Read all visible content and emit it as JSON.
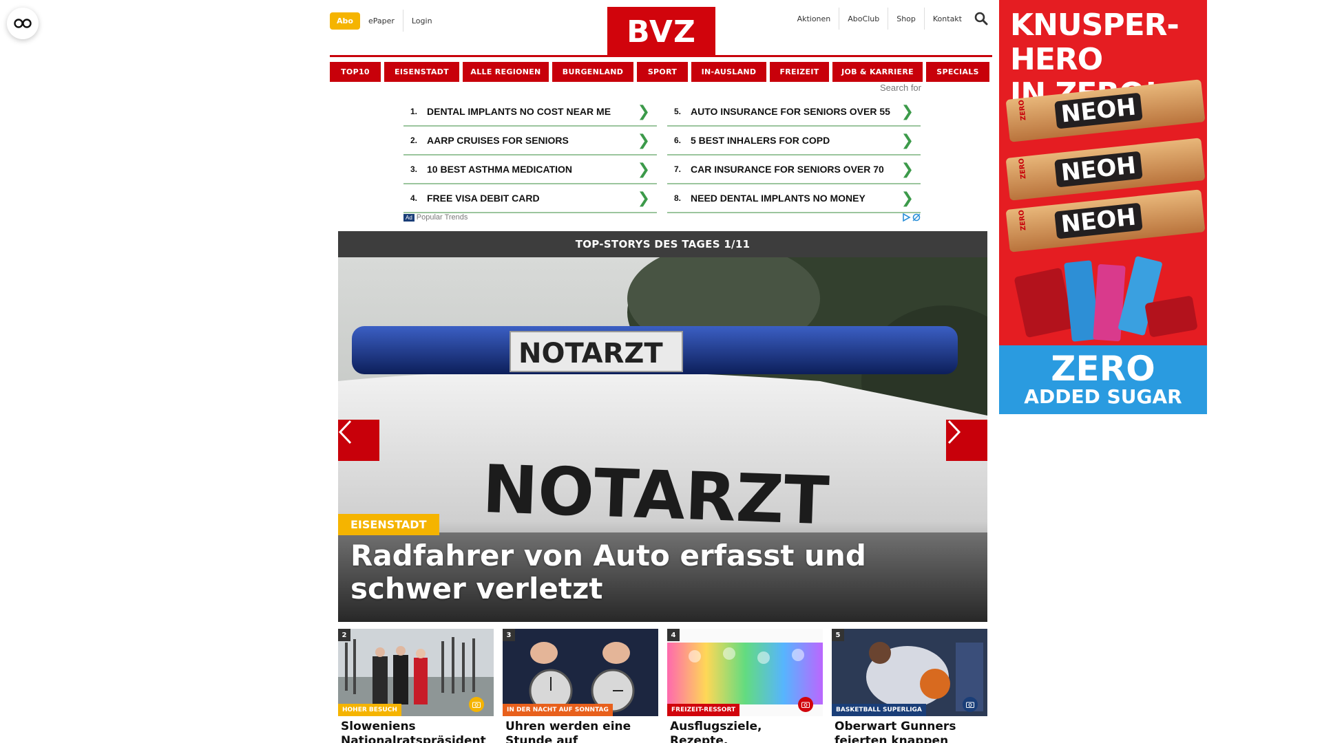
{
  "header": {
    "abo_label": "Abo",
    "epaper_label": "ePaper",
    "login_label": "Login",
    "logo_text": "BVZ",
    "right_links": [
      "Aktionen",
      "AboClub",
      "Shop",
      "Kontakt"
    ]
  },
  "nav": [
    "TOP10",
    "EISENSTADT",
    "ALLE REGIONEN",
    "BURGENLAND",
    "SPORT",
    "IN-AUSLAND",
    "FREIZEIT",
    "JOB & KARRIERE",
    "SPECIALS"
  ],
  "trends": {
    "search_for": "Search for",
    "left": [
      {
        "num": "1.",
        "text": "DENTAL IMPLANTS NO COST NEAR ME"
      },
      {
        "num": "2.",
        "text": "AARP CRUISES FOR SENIORS"
      },
      {
        "num": "3.",
        "text": "10 BEST ASTHMA MEDICATION"
      },
      {
        "num": "4.",
        "text": "FREE VISA DEBIT CARD"
      }
    ],
    "right": [
      {
        "num": "5.",
        "text": "AUTO INSURANCE FOR SENIORS OVER 55"
      },
      {
        "num": "6.",
        "text": "5 BEST INHALERS FOR COPD"
      },
      {
        "num": "7.",
        "text": "CAR INSURANCE FOR SENIORS OVER 70"
      },
      {
        "num": "8.",
        "text": "NEED DENTAL IMPLANTS NO MONEY"
      }
    ],
    "arrow": "❯",
    "ad_badge": "Ad",
    "ad_source": "Popular Trends"
  },
  "hero": {
    "heading": "TOP-STORYS DES TAGES 1/11",
    "tag": "EISENSTADT",
    "title": "Radfahrer von Auto erfasst und schwer verletzt",
    "image_text": "NOTARZT",
    "image_text_large": "NOTARZT"
  },
  "teasers": [
    {
      "num": "2",
      "tag": "HOHER BESUCH",
      "tag_color": "#f5b400",
      "cam_color": "#f5b400",
      "title": "Sloweniens Nationalratspräsident"
    },
    {
      "num": "3",
      "tag": "IN DER NACHT AUF SONNTAG",
      "tag_color": "#e8601c",
      "cam_color": "",
      "title": "Uhren werden eine Stunde auf Sommerzeit"
    },
    {
      "num": "4",
      "tag": "FREIZEIT-RESSORT",
      "tag_color": "#d1040c",
      "cam_color": "#d1040c",
      "title": "Ausflugsziele, Rezepte, Gesundheitstipps und"
    },
    {
      "num": "5",
      "tag": "BASKETBALL SUPERLIGA",
      "tag_color": "#1a3e78",
      "cam_color": "#1a3e78",
      "title": "Oberwart Gunners feierten knappen"
    }
  ],
  "ad": {
    "headline_1": "KNUSPER-HERO",
    "headline_2": "IN ZERO!",
    "bar_label": "NEOH",
    "bar_side": "ZERO",
    "zero": "ZERO",
    "sugar": "ADDED SUGAR"
  },
  "icons": {
    "reader": "glasses-icon",
    "search": "search-icon",
    "prev": "chevron-left-icon",
    "next": "chevron-right-icon",
    "camera": "camera-icon"
  },
  "colors": {
    "brand_red": "#c8000a",
    "accent_yellow": "#f5b400",
    "trend_green": "#3c9a4a",
    "hero_head_bg": "#3d3d3d"
  }
}
